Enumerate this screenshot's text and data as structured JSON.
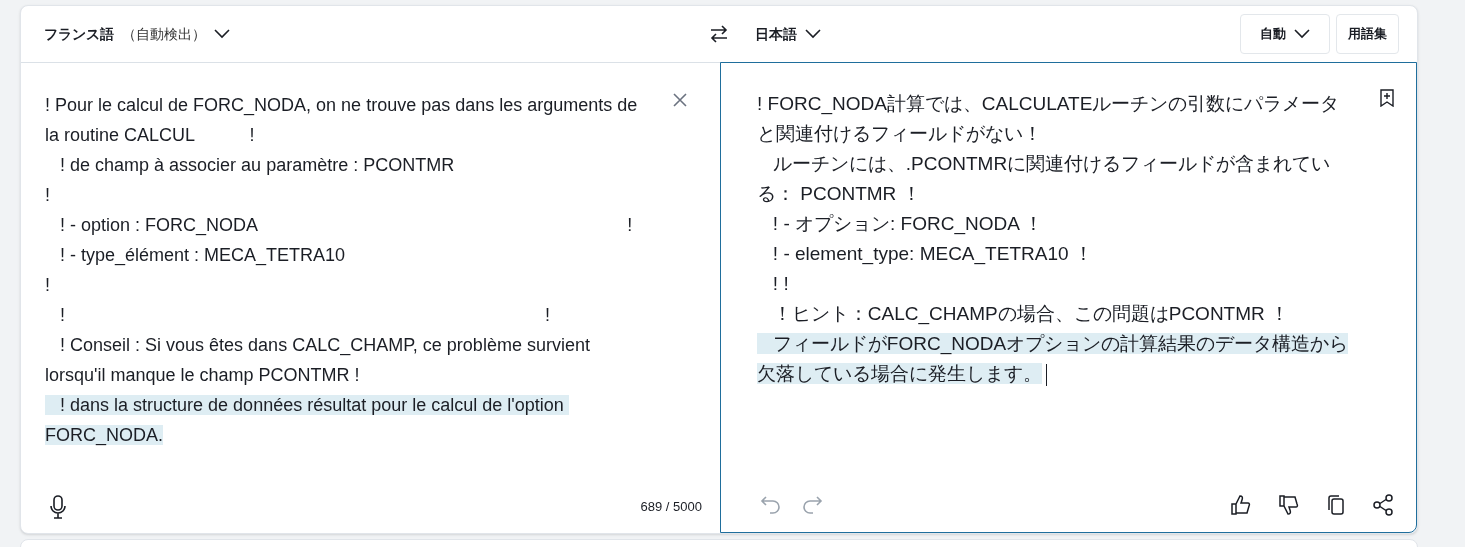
{
  "source_language": {
    "name": "フランス語",
    "detected": "（自動検出）"
  },
  "target_language": {
    "name": "日本語"
  },
  "formality": {
    "label": "自動"
  },
  "glossary_button": "用語集",
  "source_text": {
    "lines": [
      {
        "text": "! Pour le calcul de FORC_NODA, on ne trouve pas dans les arguments de la routine CALCUL           !",
        "highlighted": false
      },
      {
        "text": "   ! de champ à associer au paramètre : PCONTMR",
        "highlighted": false
      },
      {
        "text": "!",
        "highlighted": false
      },
      {
        "text": "   ! - option : FORC_NODA                                                                          !",
        "highlighted": false
      },
      {
        "text": "   ! - type_élément : MECA_TETRA10",
        "highlighted": false
      },
      {
        "text": "!",
        "highlighted": false
      },
      {
        "text": "   !                                                                                                !",
        "highlighted": false
      },
      {
        "text": "   ! Conseil : Si vous êtes dans CALC_CHAMP, ce problème survient lorsqu'il manque le champ PCONTMR !",
        "highlighted": false
      },
      {
        "text": "   ! dans la structure de données résultat pour le calcul de l'option FORC_NODA.",
        "highlighted": true
      }
    ]
  },
  "char_count": "689 / 5000",
  "target_text": {
    "lines": [
      {
        "text": "! FORC_NODA計算では、CALCULATEルーチンの引数にパラメータと関連付けるフィールドがない！",
        "highlighted": false
      },
      {
        "text": "   ルーチンには、.PCONTMRに関連付けるフィールドが含まれている： PCONTMR ！",
        "highlighted": false
      },
      {
        "text": "   ! - オプション: FORC_NODA ！",
        "highlighted": false
      },
      {
        "text": "   ! - element_type: MECA_TETRA10 ！",
        "highlighted": false
      },
      {
        "text": "   ! !",
        "highlighted": false
      },
      {
        "text": "   ！ヒント：CALC_CHAMPの場合、この問題はPCONTMR ！",
        "highlighted": false
      },
      {
        "text": "   フィールドがFORC_NODAオプションの計算結果のデータ構造から欠落している場合に発生します。",
        "highlighted": true
      }
    ]
  }
}
